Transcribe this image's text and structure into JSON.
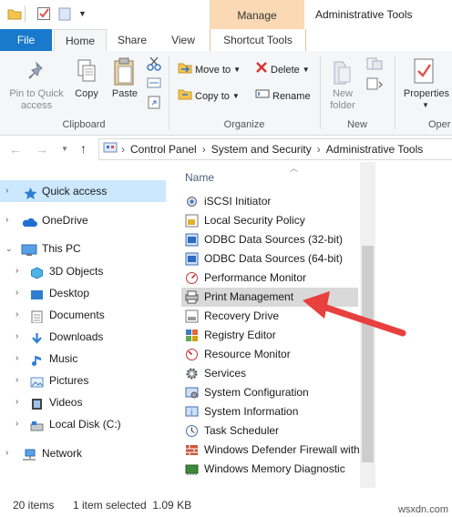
{
  "window": {
    "title": "Administrative Tools",
    "manage_tab": "Manage"
  },
  "tabs": {
    "file": "File",
    "home": "Home",
    "share": "Share",
    "view": "View",
    "shortcut_tools": "Shortcut Tools"
  },
  "ribbon": {
    "pin": "Pin to Quick access",
    "copy": "Copy",
    "paste": "Paste",
    "clipboard": "Clipboard",
    "move_to": "Move to",
    "copy_to": "Copy to",
    "delete": "Delete",
    "rename": "Rename",
    "organize": "Organize",
    "new_folder": "New folder",
    "new": "New",
    "properties": "Properties",
    "open": "Oper"
  },
  "address": {
    "parts": [
      "Control Panel",
      "System and Security",
      "Administrative Tools"
    ]
  },
  "nav": {
    "quick_access": "Quick access",
    "onedrive": "OneDrive",
    "this_pc": "This PC",
    "objects3d": "3D Objects",
    "desktop": "Desktop",
    "documents": "Documents",
    "downloads": "Downloads",
    "music": "Music",
    "pictures": "Pictures",
    "videos": "Videos",
    "local_disk": "Local Disk (C:)",
    "network": "Network"
  },
  "list": {
    "header": "Name",
    "items": [
      "iSCSI Initiator",
      "Local Security Policy",
      "ODBC Data Sources (32-bit)",
      "ODBC Data Sources (64-bit)",
      "Performance Monitor",
      "Print Management",
      "Recovery Drive",
      "Registry Editor",
      "Resource Monitor",
      "Services",
      "System Configuration",
      "System Information",
      "Task Scheduler",
      "Windows Defender Firewall with",
      "Windows Memory Diagnostic"
    ]
  },
  "status": {
    "count": "20 items",
    "selection": "1 item selected  1.09 KB"
  },
  "watermark": "wsxdn.com",
  "colors": {
    "accent": "#1979ca",
    "manage": "#fbd9b4",
    "selection": "#cce8ff",
    "arrow": "#e8403f"
  }
}
